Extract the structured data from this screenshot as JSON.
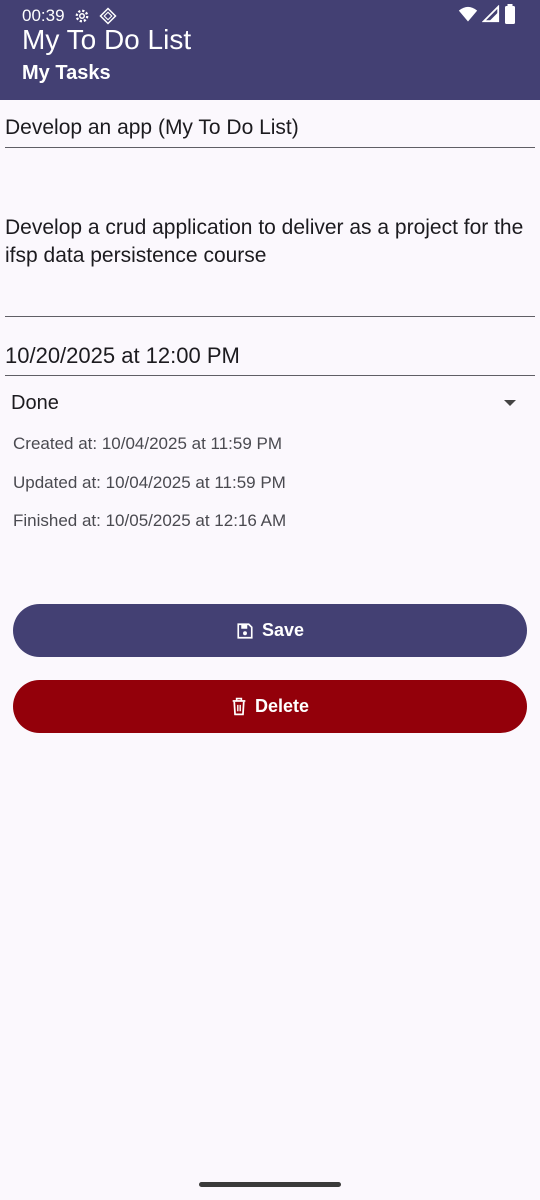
{
  "status_bar": {
    "time": "00:39",
    "left_icons": [
      "settings-icon",
      "diamond-icon"
    ],
    "right_icons": [
      "wifi-icon",
      "signal-icon",
      "battery-icon"
    ]
  },
  "app_bar": {
    "title": "My To Do List",
    "subtitle": "My Tasks",
    "color": "#434073"
  },
  "form": {
    "title_value": "Develop an app (My To Do List)",
    "description_value": "Develop a crud application to deliver as a project for the ifsp data persistence course",
    "due_date_value": "10/20/2025 at 12:00 PM",
    "status_selected": "Done"
  },
  "meta": {
    "created": "Created at: 10/04/2025 at 11:59 PM",
    "updated": "Updated at: 10/04/2025 at 11:59 PM",
    "finished": "Finished at: 10/05/2025 at 12:16 AM"
  },
  "actions": {
    "save_label": "Save",
    "save_icon": "save-icon",
    "save_color": "#434073",
    "delete_label": "Delete",
    "delete_icon": "trash-icon",
    "delete_color": "#93000a"
  }
}
